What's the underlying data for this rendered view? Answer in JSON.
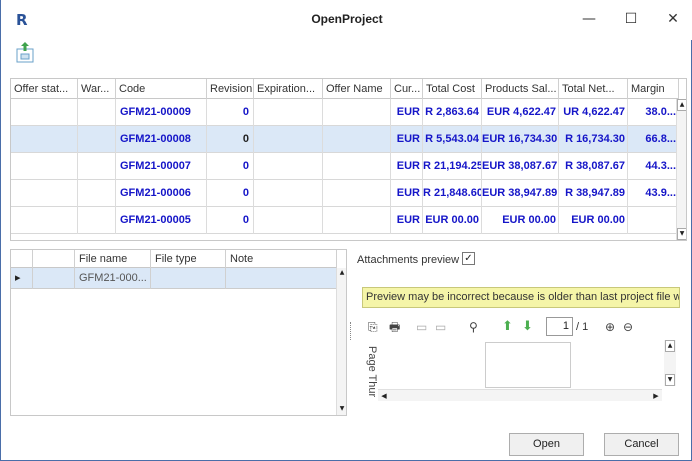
{
  "window": {
    "app_icon": "R",
    "title": "OpenProject",
    "minimize": "—",
    "maximize": "☐",
    "close": "✕"
  },
  "toolbar": {
    "icon": "export-open-icon"
  },
  "offers_grid": {
    "columns": [
      "Offer stat...",
      "War...",
      "Code",
      "Revision",
      "Expiration...",
      "Offer Name",
      "Cur...",
      "Total Cost",
      "Products Sal...",
      "Total Net...",
      "Margin"
    ],
    "rows": [
      {
        "status": "",
        "war": "",
        "code": "GFM21-00009",
        "revision": "0",
        "expiration": "",
        "offer_name": "",
        "currency": "EUR",
        "total_cost": "R 2,863.64",
        "products_sales": "EUR 4,622.47",
        "total_net": "UR 4,622.47",
        "margin": "38.0..."
      },
      {
        "status": "",
        "war": "",
        "code": "GFM21-00008",
        "revision": "0",
        "expiration": "",
        "offer_name": "",
        "currency": "EUR",
        "total_cost": "R 5,543.04",
        "products_sales": "EUR 16,734.30",
        "total_net": "R 16,734.30",
        "margin": "66.8..."
      },
      {
        "status": "",
        "war": "",
        "code": "GFM21-00007",
        "revision": "0",
        "expiration": "",
        "offer_name": "",
        "currency": "EUR",
        "total_cost": "R 21,194.25",
        "products_sales": "EUR 38,087.67",
        "total_net": "R 38,087.67",
        "margin": "44.3..."
      },
      {
        "status": "",
        "war": "",
        "code": "GFM21-00006",
        "revision": "0",
        "expiration": "",
        "offer_name": "",
        "currency": "EUR",
        "total_cost": "R 21,848.60",
        "products_sales": "EUR 38,947.89",
        "total_net": "R 38,947.89",
        "margin": "43.9..."
      },
      {
        "status": "",
        "war": "",
        "code": "GFM21-00005",
        "revision": "0",
        "expiration": "",
        "offer_name": "",
        "currency": "EUR",
        "total_cost": "EUR 00.00",
        "products_sales": "EUR 00.00",
        "total_net": "EUR 00.00",
        "margin": ""
      }
    ],
    "selected_row": 1
  },
  "attachments_grid": {
    "columns": [
      "File name",
      "File type",
      "Note"
    ],
    "rows": [
      {
        "indicator": "▸",
        "file_name": "GFM21-000...",
        "file_type": "",
        "note": ""
      }
    ]
  },
  "preview": {
    "label": "Attachments preview",
    "checked": "✓",
    "notice": "Preview may be incorrect because is older than last project file w",
    "page_current": "1",
    "page_total": "/ 1",
    "thumbnails_label": "Page Thur",
    "tools": [
      "copy-icon",
      "print-icon",
      "single-page-icon",
      "two-page-icon",
      "find-icon",
      "previous-page-icon",
      "next-page-icon",
      "zoom-in-icon",
      "zoom-out-icon"
    ]
  },
  "buttons": {
    "open": "Open",
    "cancel": "Cancel"
  }
}
